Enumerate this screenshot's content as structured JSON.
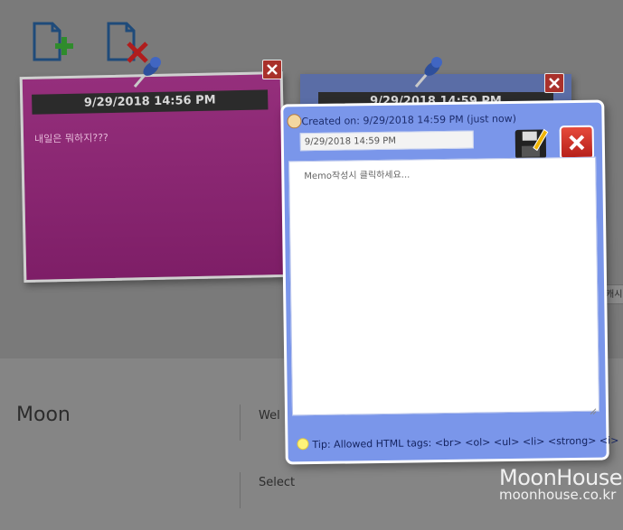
{
  "toolbar": {
    "new_note_icon": "add-note-icon",
    "delete_note_icon": "delete-note-icon"
  },
  "notes": [
    {
      "header": "9/29/2018 14:56 PM",
      "text": "내일은 뭐하지???",
      "color": "#8a266f"
    },
    {
      "header": "9/29/2018 14:59 PM",
      "color": "#5a6da6"
    }
  ],
  "editor": {
    "created_label": "Created on: 9/29/2018 14:59 PM (just now)",
    "date_value": "9/29/2018 14:59 PM",
    "placeholder": "Memo작성시 클릭하세요...",
    "tip": "Tip: Allowed HTML tags: <br> <ol> <ul> <li> <strong> <i>",
    "background": "#7a96ea"
  },
  "page_behind": {
    "name": "Moon",
    "partial_label": "Wel",
    "select_label": "Select",
    "side_tab": "캐시"
  },
  "watermark": {
    "line1": "MoonHouse",
    "line2": "moonhouse.co.kr"
  }
}
